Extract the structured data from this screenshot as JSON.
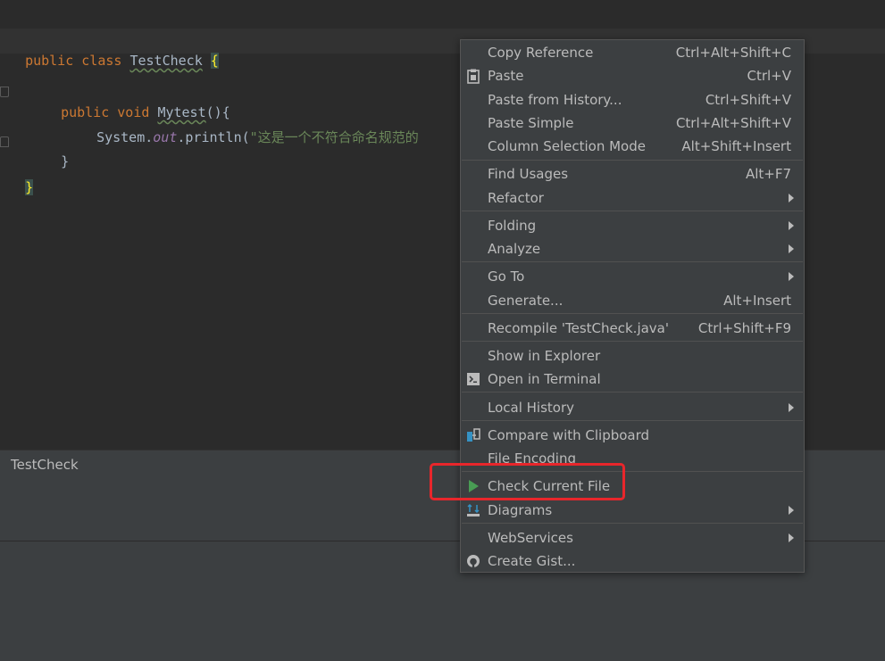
{
  "editor": {
    "code": {
      "l1_public": "public",
      "l1_class": "class",
      "l1_name": "TestCheck",
      "l1_brace": "{",
      "l2_public": "public",
      "l2_void": "void",
      "l2_method": "Mytest",
      "l2_rest": "(){",
      "l3_sys": "System.",
      "l3_out": "out",
      "l3_println": ".println(",
      "l3_str": "\"这是一个不符合命名规范的",
      "l4_close": "}",
      "l5_close": "}"
    }
  },
  "panel": {
    "title": "TestCheck"
  },
  "context_menu": {
    "items": [
      {
        "label": "Copy Reference",
        "shortcut": "Ctrl+Alt+Shift+C"
      },
      {
        "label": "Paste",
        "shortcut": "Ctrl+V",
        "icon": "clipboard-icon"
      },
      {
        "label": "Paste from History...",
        "shortcut": "Ctrl+Shift+V"
      },
      {
        "label": "Paste Simple",
        "shortcut": "Ctrl+Alt+Shift+V"
      },
      {
        "label": "Column Selection Mode",
        "shortcut": "Alt+Shift+Insert"
      },
      {
        "label": "Find Usages",
        "shortcut": "Alt+F7"
      },
      {
        "label": "Refactor",
        "submenu": true
      },
      {
        "label": "Folding",
        "submenu": true
      },
      {
        "label": "Analyze",
        "submenu": true
      },
      {
        "label": "Go To",
        "submenu": true
      },
      {
        "label": "Generate...",
        "shortcut": "Alt+Insert"
      },
      {
        "label": "Recompile 'TestCheck.java'",
        "shortcut": "Ctrl+Shift+F9"
      },
      {
        "label": "Show in Explorer"
      },
      {
        "label": "Open in Terminal",
        "icon": "terminal-icon"
      },
      {
        "label": "Local History",
        "submenu": true
      },
      {
        "label": "Compare with Clipboard",
        "icon": "compare-icon"
      },
      {
        "label": "File Encoding"
      },
      {
        "label": "Check Current File",
        "icon": "run-icon"
      },
      {
        "label": "Diagrams",
        "submenu": true,
        "icon": "diagram-icon"
      },
      {
        "label": "WebServices",
        "submenu": true
      },
      {
        "label": "Create Gist...",
        "icon": "github-icon"
      }
    ]
  },
  "colors": {
    "editor_bg": "#2b2b2b",
    "menu_bg": "#3c3f41",
    "keyword": "#cc7832",
    "string": "#6a8759",
    "highlight_box": "#e8262b",
    "run_icon": "#499c54"
  }
}
